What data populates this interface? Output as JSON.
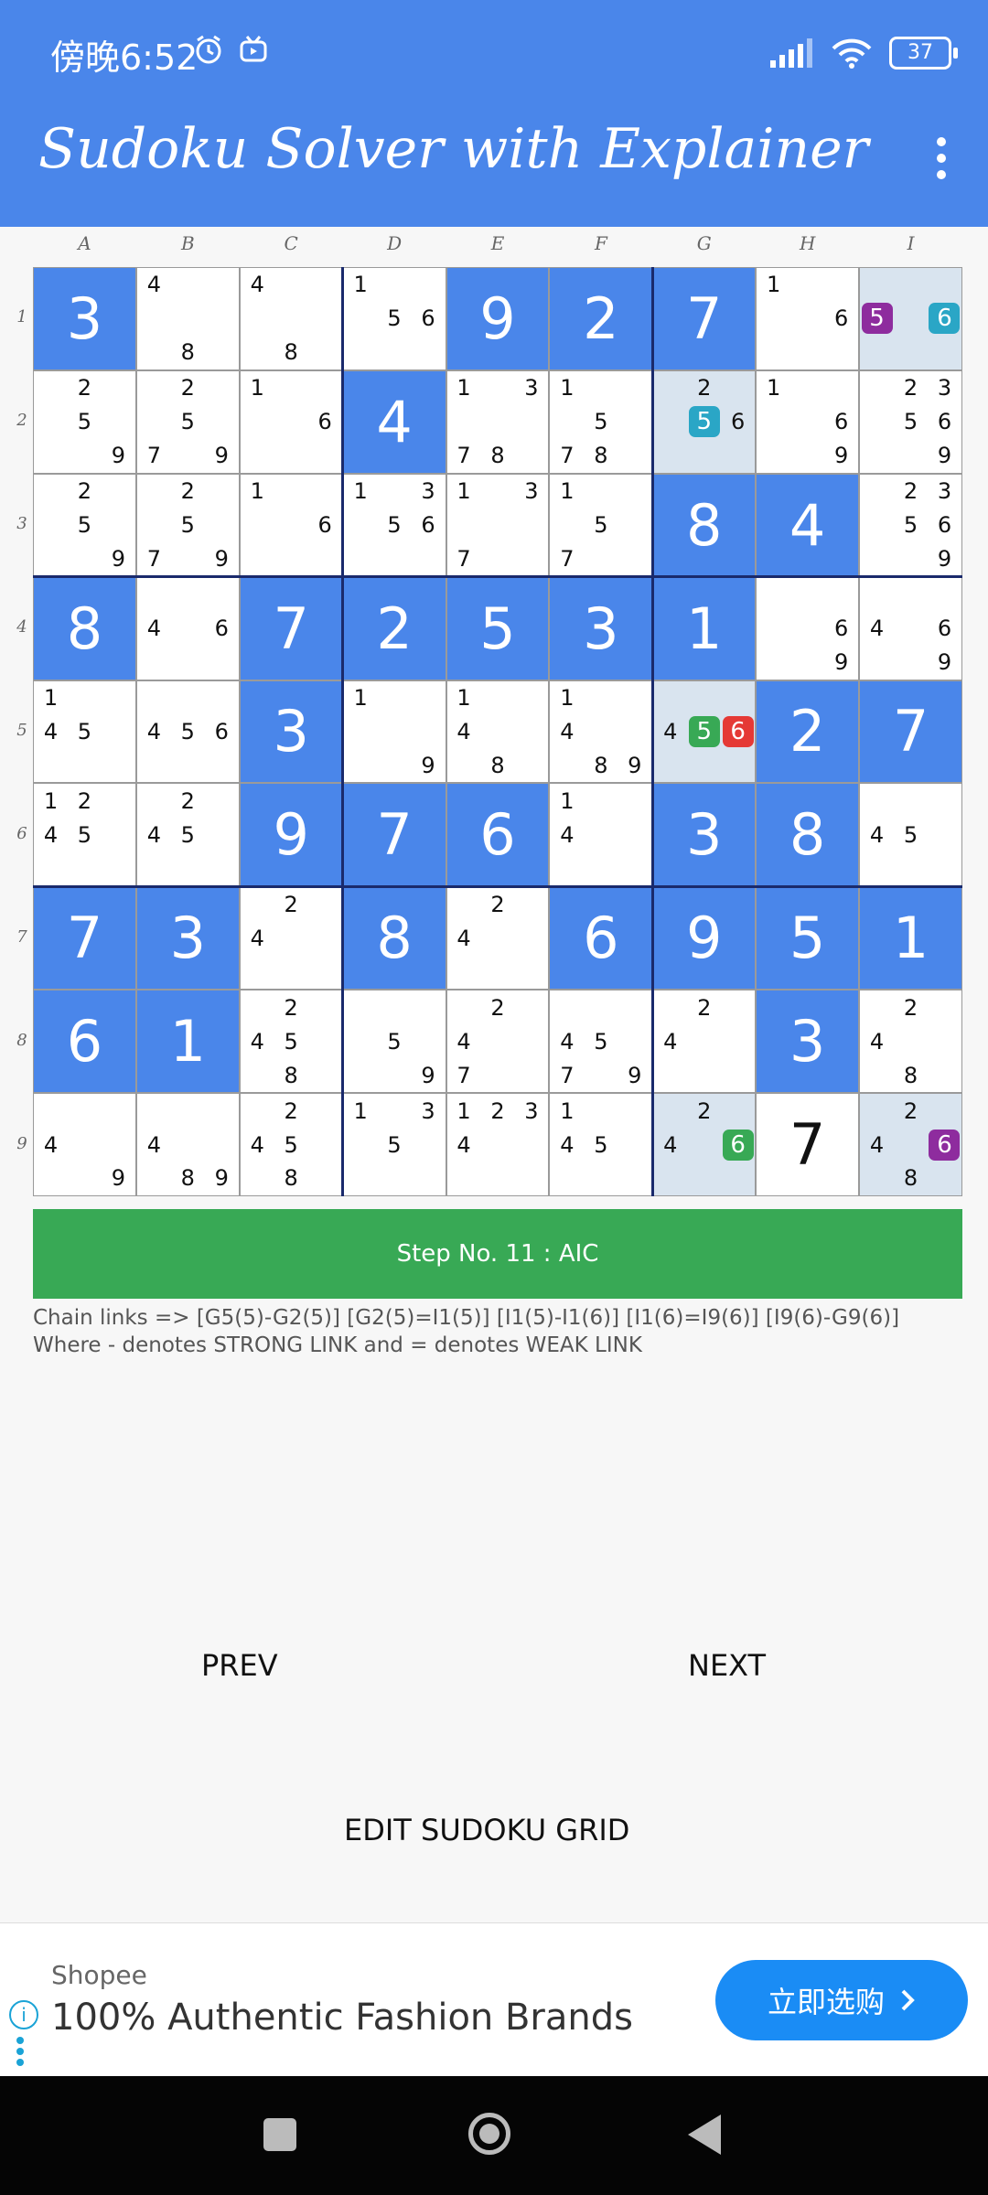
{
  "status_bar": {
    "time": "傍晚6:52",
    "battery": "37"
  },
  "app": {
    "title": "Sudoku Solver with Explainer"
  },
  "grid": {
    "column_headers": [
      "A",
      "B",
      "C",
      "D",
      "E",
      "F",
      "G",
      "H",
      "I"
    ],
    "row_headers": [
      "1",
      "2",
      "3",
      "4",
      "5",
      "6",
      "7",
      "8",
      "9"
    ],
    "colors": {
      "given": "#4a86ea",
      "highlight": "#d9e4ef",
      "chip_purple": "#8e2c9e",
      "chip_teal": "#2aa6c6",
      "chip_green": "#38a955",
      "chip_red": "#e53935"
    },
    "cells": [
      [
        {
          "v": "3"
        },
        {
          "c": [
            "4",
            "",
            "",
            "",
            "",
            "",
            "",
            "8",
            ""
          ]
        },
        {
          "c": [
            "4",
            "",
            "",
            "",
            "",
            "",
            "",
            "8",
            ""
          ]
        },
        {
          "c": [
            "1",
            "",
            "",
            "",
            "5",
            "6",
            "",
            "",
            ""
          ]
        },
        {
          "v": "9"
        },
        {
          "v": "2"
        },
        {
          "v": "7"
        },
        {
          "c": [
            "1",
            "",
            "",
            "",
            "",
            "6",
            "",
            "",
            ""
          ]
        },
        {
          "hl": true,
          "c": [
            "",
            "",
            "",
            "5",
            "",
            "6",
            "",
            "",
            ""
          ],
          "chips": {
            "3": "purple",
            "5": "teal"
          }
        }
      ],
      [
        {
          "c": [
            "",
            "2",
            "",
            "",
            "5",
            "",
            "",
            "",
            "9"
          ]
        },
        {
          "c": [
            "",
            "2",
            "",
            "",
            "5",
            "",
            "7",
            "",
            "9"
          ]
        },
        {
          "c": [
            "1",
            "",
            "",
            "",
            "",
            "6",
            "",
            "",
            ""
          ]
        },
        {
          "v": "4"
        },
        {
          "c": [
            "1",
            "",
            "3",
            "",
            "",
            "",
            "7",
            "8",
            ""
          ]
        },
        {
          "c": [
            "1",
            "",
            "",
            "",
            "5",
            "",
            "7",
            "8",
            ""
          ]
        },
        {
          "hl": true,
          "c": [
            "",
            "2",
            "",
            "",
            "5",
            "6",
            "",
            "",
            ""
          ],
          "chips": {
            "4": "teal"
          }
        },
        {
          "c": [
            "1",
            "",
            "",
            "",
            "",
            "6",
            "",
            "",
            "9"
          ]
        },
        {
          "c": [
            "",
            "2",
            "3",
            "",
            "5",
            "6",
            "",
            "",
            "9"
          ]
        }
      ],
      [
        {
          "c": [
            "",
            "2",
            "",
            "",
            "5",
            "",
            "",
            "",
            "9"
          ]
        },
        {
          "c": [
            "",
            "2",
            "",
            "",
            "5",
            "",
            "7",
            "",
            "9"
          ]
        },
        {
          "c": [
            "1",
            "",
            "",
            "",
            "",
            "6",
            "",
            "",
            ""
          ]
        },
        {
          "c": [
            "1",
            "",
            "3",
            "",
            "5",
            "6",
            "",
            "",
            ""
          ]
        },
        {
          "c": [
            "1",
            "",
            "3",
            "",
            "",
            "",
            "7",
            "",
            ""
          ]
        },
        {
          "c": [
            "1",
            "",
            "",
            "",
            "5",
            "",
            "7",
            "",
            ""
          ]
        },
        {
          "v": "8"
        },
        {
          "v": "4"
        },
        {
          "c": [
            "",
            "2",
            "3",
            "",
            "5",
            "6",
            "",
            "",
            "9"
          ]
        }
      ],
      [
        {
          "v": "8"
        },
        {
          "c": [
            "",
            "",
            "",
            "4",
            "",
            "6",
            "",
            "",
            ""
          ]
        },
        {
          "v": "7"
        },
        {
          "v": "2"
        },
        {
          "v": "5"
        },
        {
          "v": "3"
        },
        {
          "v": "1"
        },
        {
          "c": [
            "",
            "",
            "",
            "",
            "",
            "6",
            "",
            "",
            "9"
          ]
        },
        {
          "c": [
            "",
            "",
            "",
            "4",
            "",
            "6",
            "",
            "",
            "9"
          ]
        }
      ],
      [
        {
          "c": [
            "1",
            "",
            "",
            "4",
            "5",
            "",
            "",
            "",
            ""
          ]
        },
        {
          "c": [
            "",
            "",
            "",
            "4",
            "5",
            "6",
            "",
            "",
            ""
          ]
        },
        {
          "v": "3"
        },
        {
          "c": [
            "1",
            "",
            "",
            "",
            "",
            "",
            "",
            "",
            "9"
          ]
        },
        {
          "c": [
            "1",
            "",
            "",
            "4",
            "",
            "",
            "",
            "8",
            ""
          ]
        },
        {
          "c": [
            "1",
            "",
            "",
            "4",
            "",
            "",
            "",
            "8",
            "9"
          ]
        },
        {
          "hl": true,
          "c": [
            "",
            "",
            "",
            "4",
            "5",
            "6",
            "",
            "",
            ""
          ],
          "chips": {
            "4": "green",
            "5": "red"
          }
        },
        {
          "v": "2"
        },
        {
          "v": "7"
        }
      ],
      [
        {
          "c": [
            "1",
            "2",
            "",
            "4",
            "5",
            "",
            "",
            "",
            ""
          ]
        },
        {
          "c": [
            "",
            "2",
            "",
            "4",
            "5",
            "",
            "",
            "",
            ""
          ]
        },
        {
          "v": "9"
        },
        {
          "v": "7"
        },
        {
          "v": "6"
        },
        {
          "c": [
            "1",
            "",
            "",
            "4",
            "",
            "",
            "",
            "",
            ""
          ]
        },
        {
          "v": "3"
        },
        {
          "v": "8"
        },
        {
          "c": [
            "",
            "",
            "",
            "4",
            "5",
            "",
            "",
            "",
            ""
          ]
        }
      ],
      [
        {
          "v": "7"
        },
        {
          "v": "3"
        },
        {
          "c": [
            "",
            "2",
            "",
            "4",
            "",
            "",
            "",
            "",
            ""
          ]
        },
        {
          "v": "8"
        },
        {
          "c": [
            "",
            "2",
            "",
            "4",
            "",
            "",
            "",
            "",
            ""
          ]
        },
        {
          "v": "6"
        },
        {
          "v": "9"
        },
        {
          "v": "5"
        },
        {
          "v": "1"
        }
      ],
      [
        {
          "v": "6"
        },
        {
          "v": "1"
        },
        {
          "c": [
            "",
            "2",
            "",
            "4",
            "5",
            "",
            "",
            "8",
            ""
          ]
        },
        {
          "c": [
            "",
            "",
            "",
            "",
            "5",
            "",
            "",
            "",
            "9"
          ]
        },
        {
          "c": [
            "",
            "2",
            "",
            "4",
            "",
            "",
            "7",
            "",
            ""
          ]
        },
        {
          "c": [
            "",
            "",
            "",
            "4",
            "5",
            "",
            "7",
            "",
            "9"
          ]
        },
        {
          "c": [
            "",
            "2",
            "",
            "4",
            "",
            "",
            "",
            "",
            ""
          ]
        },
        {
          "v": "3"
        },
        {
          "c": [
            "",
            "2",
            "",
            "4",
            "",
            "",
            "",
            "8",
            ""
          ]
        }
      ],
      [
        {
          "c": [
            "",
            "",
            "",
            "4",
            "",
            "",
            "",
            "",
            "9"
          ]
        },
        {
          "c": [
            "",
            "",
            "",
            "4",
            "",
            "",
            "",
            "8",
            "9"
          ]
        },
        {
          "c": [
            "",
            "2",
            "",
            "4",
            "5",
            "",
            "",
            "8",
            ""
          ]
        },
        {
          "c": [
            "1",
            "",
            "3",
            "",
            "5",
            "",
            "",
            "",
            ""
          ]
        },
        {
          "c": [
            "1",
            "2",
            "3",
            "4",
            "",
            "",
            "",
            "",
            ""
          ]
        },
        {
          "c": [
            "1",
            "",
            "",
            "4",
            "5",
            "",
            "",
            "",
            ""
          ]
        },
        {
          "hl": true,
          "c": [
            "",
            "2",
            "",
            "4",
            "",
            "6",
            "",
            "",
            ""
          ],
          "chips": {
            "5": "green"
          }
        },
        {
          "v": "7",
          "placed": true
        },
        {
          "hl": true,
          "c": [
            "",
            "2",
            "",
            "4",
            "",
            "6",
            "",
            "8",
            ""
          ],
          "chips": {
            "5": "purple"
          }
        }
      ]
    ]
  },
  "step": {
    "label": "Step No. 11 :  AIC"
  },
  "explanation": {
    "chain": "Chain links => [G5(5)-G2(5)] [G2(5)=I1(5)] [I1(5)-I1(6)] [I1(6)=I9(6)] [I9(6)-G9(6)]",
    "legend": "Where - denotes STRONG LINK and = denotes WEAK LINK"
  },
  "buttons": {
    "prev": "PREV",
    "next": "NEXT",
    "edit": "EDIT SUDOKU GRID"
  },
  "ad": {
    "source": "Shopee",
    "title": "100% Authentic Fashion Brands",
    "cta": "立即选购"
  }
}
